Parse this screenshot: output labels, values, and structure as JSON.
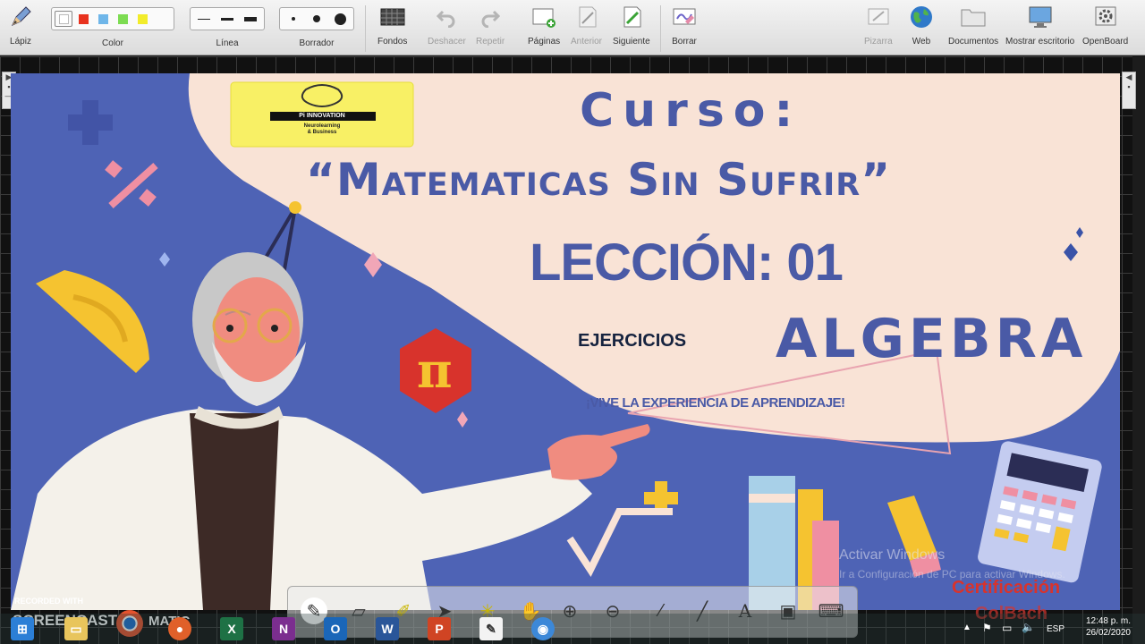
{
  "toolbar": {
    "pencil": "Lápiz",
    "color": "Color",
    "line": "Línea",
    "eraser": "Borrador",
    "backgrounds": "Fondos",
    "undo": "Deshacer",
    "redo": "Repetir",
    "pages": "Páginas",
    "previous": "Anterior",
    "next": "Siguiente",
    "clear": "Borrar",
    "board": "Pizarra",
    "web": "Web",
    "documents": "Documentos",
    "show_desktop": "Mostrar escritorio",
    "app": "OpenBoard",
    "colors": [
      "#ffffff",
      "#e8321e",
      "#6fb6e9",
      "#7ddc52",
      "#f2ec2b"
    ]
  },
  "slide": {
    "logo_brand": "Pi INNOVATION",
    "logo_tagline_1": "Neurolearning",
    "logo_tagline_2": "& Business",
    "course_label": "Curso:",
    "course_title": "“Matematicas Sin Sufrir”",
    "lesson": "LECCIÓN: 01",
    "subject": "ALGEBRA",
    "section": "EJERCICIOS",
    "slogan": "¡VIVE LA EXPERIENCIA DE APRENDIZAJE!",
    "pi_symbol": "π",
    "certification_1": "Certificación",
    "certification_2": "ColBach",
    "colors": {
      "background": "#4e63b5",
      "cream": "#f9e3d6",
      "title_blue": "#4a5aa6",
      "red": "#d8332c"
    }
  },
  "watermark": {
    "activate_title": "Activar Windows",
    "activate_sub": "Ir a Configuración de PC para activar Windows."
  },
  "recorder": {
    "recorded_with": "RECORDED WITH",
    "brand": "SCREENCAST",
    "brand_suffix": "MATIC"
  },
  "taskbar": {
    "language": "ESP",
    "time": "12:48 p. m.",
    "date": "26/02/2020"
  }
}
